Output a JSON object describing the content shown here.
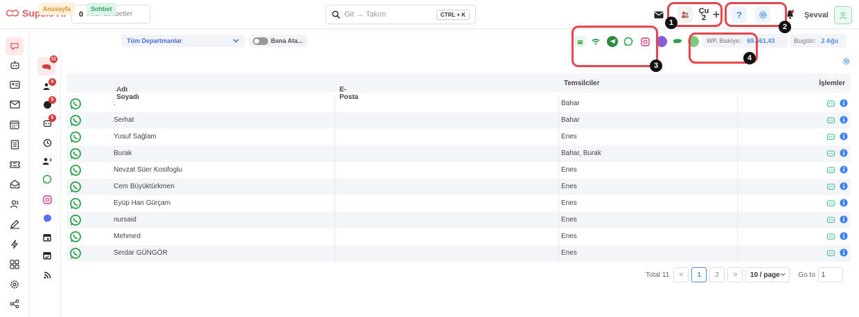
{
  "app": {
    "name": "Supsis Ai"
  },
  "topbar": {
    "active_chats_count": "0",
    "active_chats_label": "Aktif Sohbetler",
    "search_placeholder": "Git → Takım",
    "search_shortcut": "CTRL + K",
    "status_label": "Çu",
    "status_sub": "2",
    "help_label": "?",
    "user_name": "Şevval"
  },
  "subbar": {
    "tab_home": "Anasayfa",
    "tab_chat": "Sohbet",
    "department": "Tüm Departmanlar",
    "toggle_label": "Bana Ata...",
    "balance_label": "WP. Bakiye:",
    "balance_value": "69.561,43",
    "today_label": "Bugün:",
    "today_value": "2 Ağu"
  },
  "subrail": {
    "badges": [
      "11",
      "0",
      "5",
      "5"
    ]
  },
  "annotations": [
    "1",
    "2",
    "3",
    "4"
  ],
  "table": {
    "columns": {
      "name": "Adı Soyadı",
      "email": "E-Posta",
      "agents": "Temsilciler",
      "actions": "İşlemler"
    },
    "rows": [
      {
        "name": ".",
        "email": "",
        "agents": "Bahar"
      },
      {
        "name": "Serhat",
        "email": "",
        "agents": "Bahar"
      },
      {
        "name": "Yusuf Sağlam",
        "email": "",
        "agents": "Enes"
      },
      {
        "name": "Burak",
        "email": "",
        "agents": "Bahar, Burak"
      },
      {
        "name": "Nevzat Süer Kosifoglu",
        "email": "",
        "agents": "Enes"
      },
      {
        "name": "Cem Büyüktürkmen",
        "email": "",
        "agents": "Enes"
      },
      {
        "name": "Eyüp Han Gürçam",
        "email": "",
        "agents": "Enes"
      },
      {
        "name": "nursaid",
        "email": "",
        "agents": "Enes"
      },
      {
        "name": "Mehmed",
        "email": "",
        "agents": "Enes"
      },
      {
        "name": "Serdar GÜNGÖR",
        "email": "",
        "agents": "Enes"
      }
    ]
  },
  "pagination": {
    "total": "Total 11",
    "prev": "<",
    "pages": [
      "1",
      "2"
    ],
    "next": ">",
    "page_size": "10 / page",
    "goto_label": "Go to",
    "goto_value": "1"
  },
  "colors": {
    "accent": "#e05a5a",
    "link": "#4a8fe0",
    "whatsapp": "#25a244",
    "annotation": "#e8444c"
  }
}
